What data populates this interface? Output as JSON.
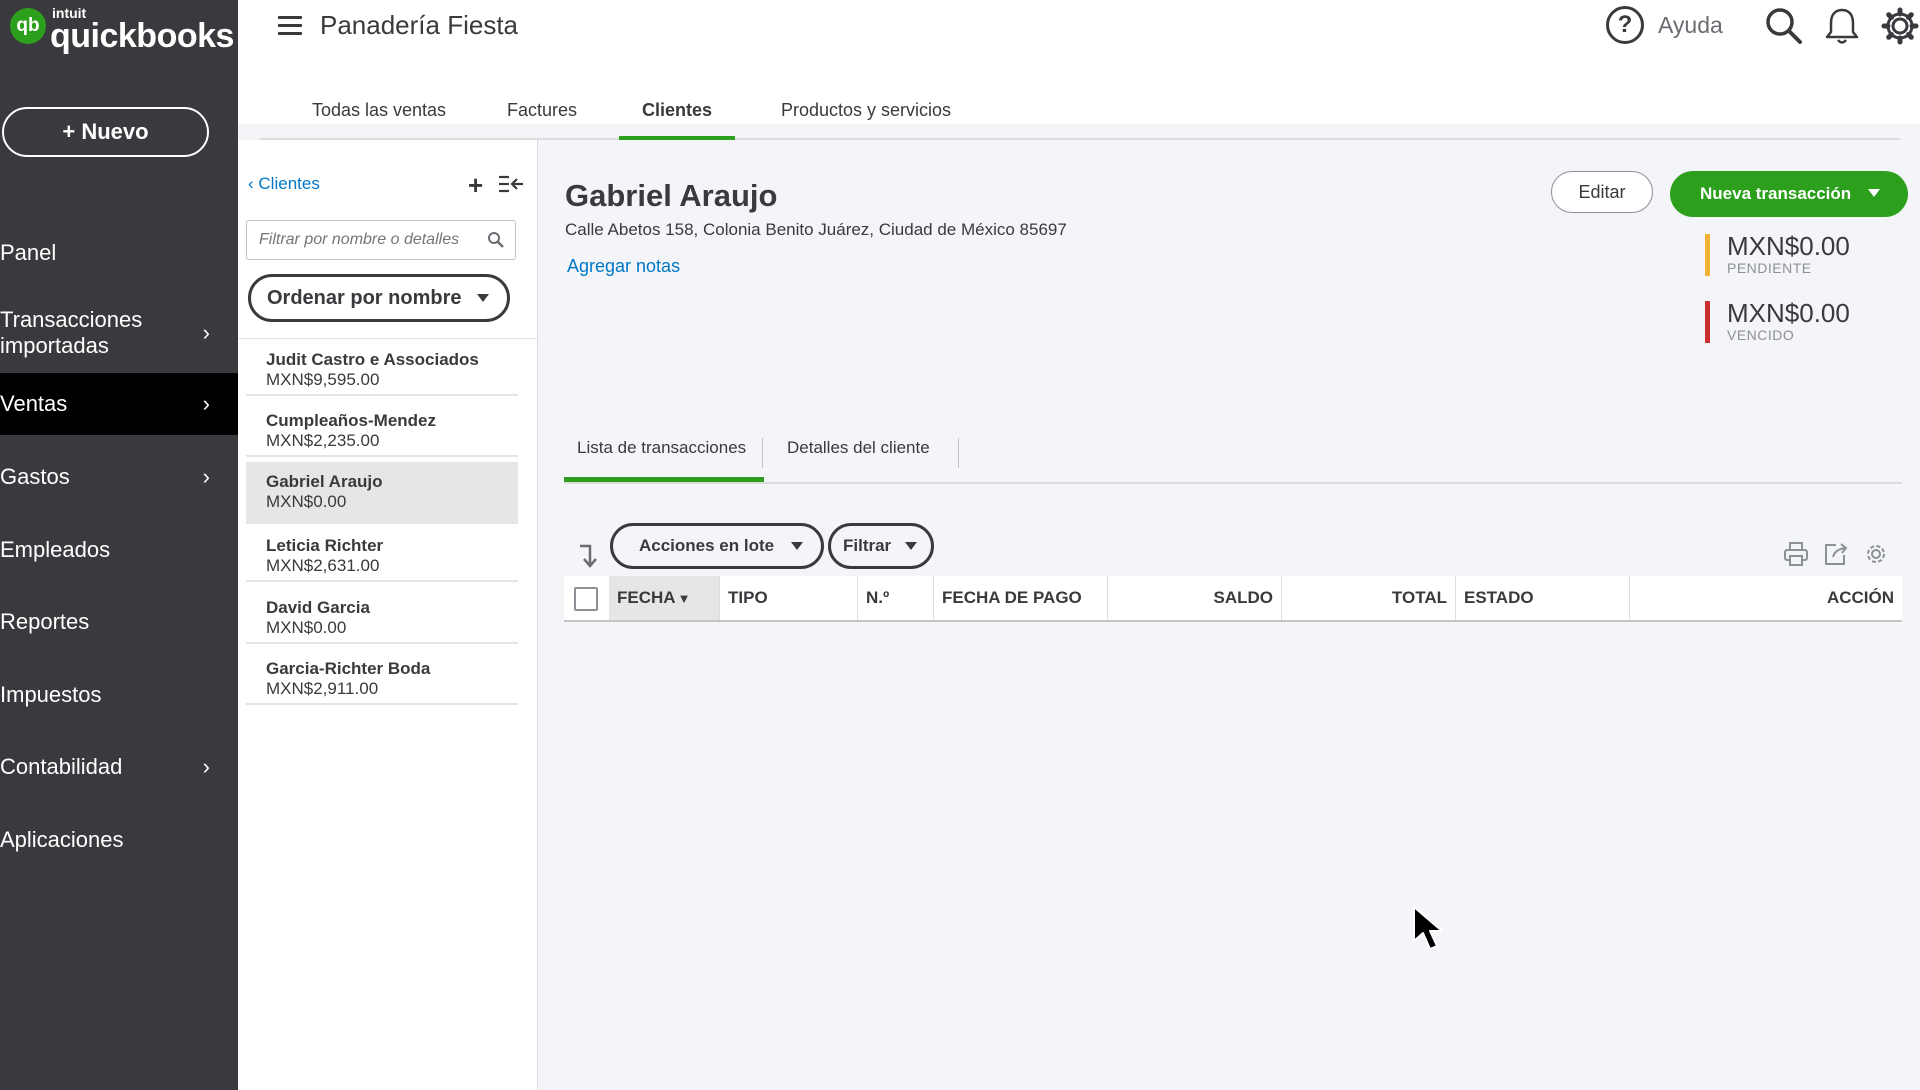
{
  "brand": {
    "intuit": "intuit",
    "name": "quickbooks",
    "mark": "qb"
  },
  "sidebar": {
    "new_button": "+ Nuevo",
    "items": [
      {
        "label": "Panel",
        "chevron": false,
        "active": false
      },
      {
        "label": "Transacciones importadas",
        "chevron": true,
        "active": false
      },
      {
        "label": "Ventas",
        "chevron": true,
        "active": true
      },
      {
        "label": "Gastos",
        "chevron": true,
        "active": false
      },
      {
        "label": "Empleados",
        "chevron": false,
        "active": false
      },
      {
        "label": "Reportes",
        "chevron": false,
        "active": false
      },
      {
        "label": "Impuestos",
        "chevron": false,
        "active": false
      },
      {
        "label": "Contabilidad",
        "chevron": true,
        "active": false
      },
      {
        "label": "Aplicaciones",
        "chevron": false,
        "active": false
      }
    ],
    "transacciones_line1": "Transacciones",
    "transacciones_line2": "importadas"
  },
  "header": {
    "company": "Panadería Fiesta",
    "help_label": "Ayuda",
    "help_glyph": "?",
    "icons": [
      "search-icon",
      "bell-icon",
      "gear-icon"
    ]
  },
  "tabs": [
    {
      "label": "Todas las ventas",
      "active": false
    },
    {
      "label": "Factures",
      "active": false
    },
    {
      "label": "Clientes",
      "active": true
    },
    {
      "label": "Productos y servicios",
      "active": false
    }
  ],
  "customer_list": {
    "back_label": "Clientes",
    "add_glyph": "+",
    "search_placeholder": "Filtrar por nombre o detalles",
    "sort_label": "Ordenar por nombre",
    "customers": [
      {
        "name": "Judit Castro e Associados",
        "amount": "MXN$9,595.00",
        "selected": false
      },
      {
        "name": "Cumpleaños-Mendez",
        "amount": "MXN$2,235.00",
        "selected": false
      },
      {
        "name": "Gabriel Araujo",
        "amount": "MXN$0.00",
        "selected": true
      },
      {
        "name": "Leticia Richter",
        "amount": "MXN$2,631.00",
        "selected": false
      },
      {
        "name": "David Garcia",
        "amount": "MXN$0.00",
        "selected": false
      },
      {
        "name": "Garcia-Richter Boda",
        "amount": "MXN$2,911.00",
        "selected": false
      }
    ]
  },
  "detail": {
    "name": "Gabriel Araujo",
    "address": "Calle Abetos 158, Colonia Benito Juárez, Ciudad de México 85697",
    "add_notes": "Agregar notas",
    "edit_button": "Editar",
    "new_transaction_button": "Nueva transacción",
    "balances": [
      {
        "amount": "MXN$0.00",
        "label": "PENDIENTE",
        "color": "#f2b233"
      },
      {
        "amount": "MXN$0.00",
        "label": "VENCIDO",
        "color": "#c9302c"
      }
    ],
    "sub_tabs": [
      {
        "label": "Lista de transacciones",
        "active": true
      },
      {
        "label": "Detalles del cliente",
        "active": false
      }
    ],
    "batch_actions": "Acciones en lote",
    "filter": "Filtrar",
    "toolbar_icons": [
      "print-icon",
      "export-icon",
      "settings-icon"
    ],
    "table_columns": [
      "FECHA",
      "TIPO",
      "N.º",
      "FECHA DE PAGO",
      "SALDO",
      "TOTAL",
      "ESTADO",
      "ACCIÓN"
    ],
    "rows": []
  },
  "colors": {
    "accent": "#2ca01c",
    "link": "#0077c5",
    "sidebar_bg": "#393a3d",
    "active_nav_bg": "#000000",
    "pending": "#f2b233",
    "overdue": "#c9302c"
  }
}
